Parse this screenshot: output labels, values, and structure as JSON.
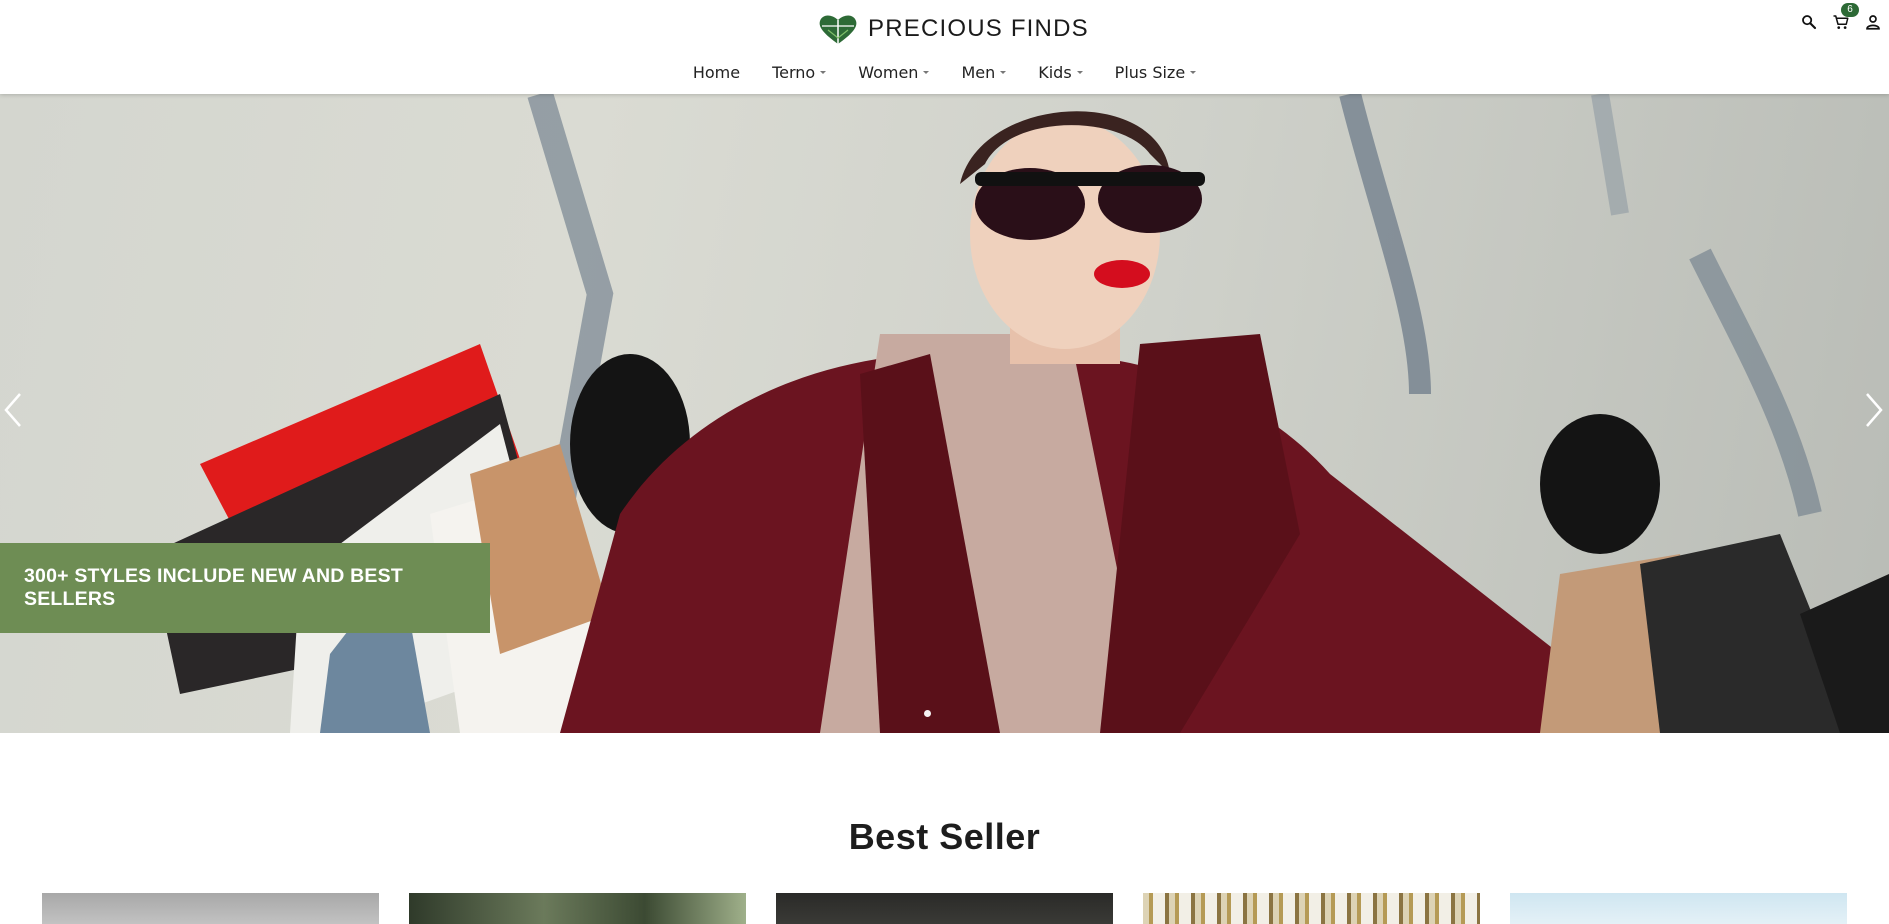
{
  "brand": {
    "name": "PRECIOUS FINDS",
    "logo_icon": "heart-leaf-logo-icon",
    "accent_color": "#2d6a36"
  },
  "nav": {
    "items": [
      {
        "label": "Home",
        "has_dropdown": false
      },
      {
        "label": "Terno",
        "has_dropdown": true
      },
      {
        "label": "Women",
        "has_dropdown": true
      },
      {
        "label": "Men",
        "has_dropdown": true
      },
      {
        "label": "Kids",
        "has_dropdown": true
      },
      {
        "label": "Plus Size",
        "has_dropdown": true
      }
    ]
  },
  "header_icons": {
    "search": "search-icon",
    "cart": "cart-icon",
    "cart_count": "6",
    "account": "account-icon"
  },
  "hero": {
    "promo_text": "300+ STYLES INCLUDE NEW AND BEST SELLERS",
    "promo_color": "#6e8d54",
    "prev_icon": "chevron-left-icon",
    "next_icon": "chevron-right-icon",
    "slide_count": 1,
    "active_slide": 1
  },
  "best_seller": {
    "title": "Best Seller",
    "product_count": 5
  }
}
